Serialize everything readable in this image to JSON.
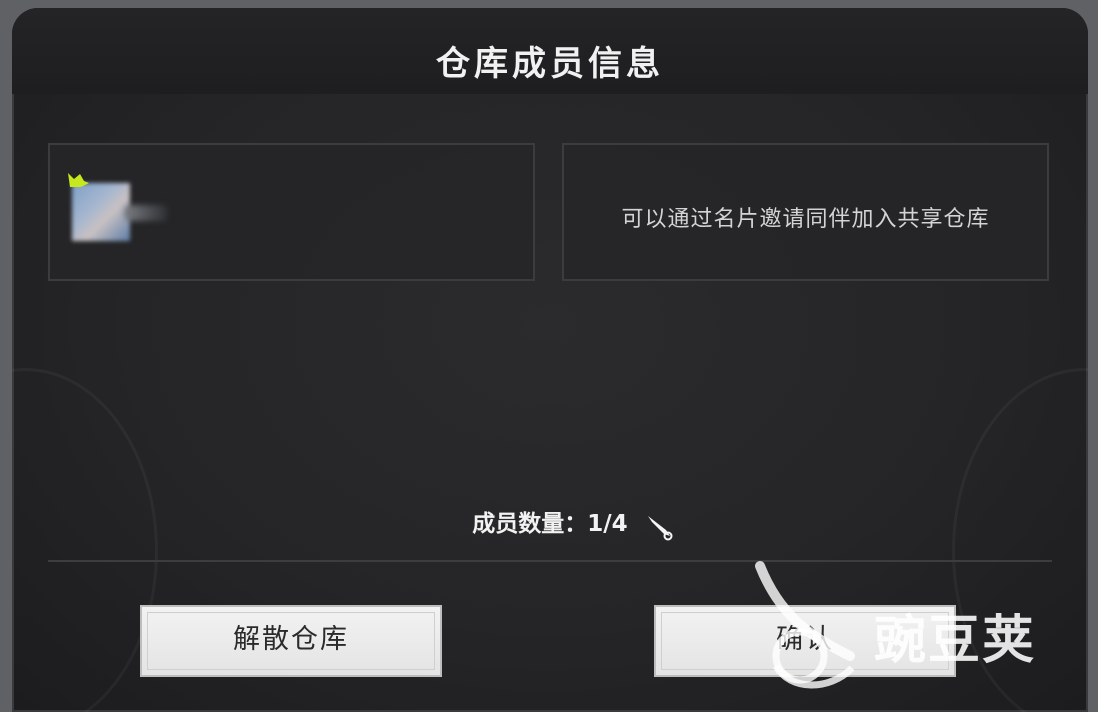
{
  "dialog": {
    "title": "仓库成员信息",
    "invite_hint": "可以通过名片邀请同伴加入共享仓库",
    "member_count_label": "成员数量：1/4"
  },
  "buttons": {
    "disband": "解散仓库",
    "confirm": "确认"
  },
  "watermark": {
    "text": "豌豆荚"
  },
  "colors": {
    "background": "#252527",
    "title": "#f1f1f1",
    "panel_border": "#3c3c3f",
    "button_bg": "#efefef",
    "leader_flag": "#c8e81e"
  }
}
